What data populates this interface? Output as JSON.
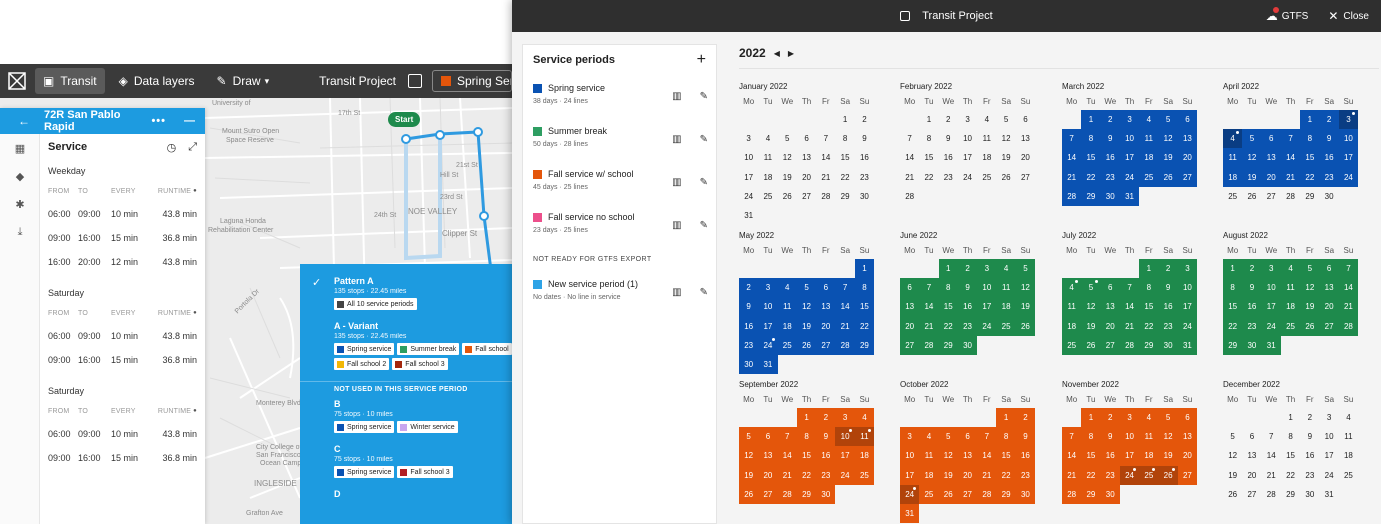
{
  "bg": {
    "toolbar": {
      "transit": "Transit",
      "data_layers": "Data layers",
      "draw": "Draw",
      "project": "Transit Project",
      "period_select": "Spring Service",
      "period_color": "#e4560b"
    },
    "map_labels": {
      "start": "Start",
      "university": "University of",
      "sutro": "Mount Sutro Open",
      "sutro2": "Space Reserve",
      "st17": "17th St",
      "fst21": "21st St",
      "hill": "Hill St",
      "st23": "23rd St",
      "st24": "24th St",
      "noe": "NOE VALLEY",
      "clipper": "Clipper St",
      "laguna": "Laguna Honda",
      "laguna2": "Rehabilitation Center",
      "portola": "Portola Dr",
      "monterey": "Monterey Blvd",
      "ccsf": "City College of",
      "ccsf2": "San Francisco",
      "ccsf3": "Ocean Campus",
      "ingleside": "INGLESIDE",
      "grafton": "Grafton Ave"
    },
    "route": {
      "name": "72R San Pablo Rapid",
      "service_title": "Service",
      "groups": [
        {
          "title": "Weekday",
          "heads": [
            "FROM",
            "TO",
            "EVERY",
            "RUNTIME"
          ],
          "rows": [
            [
              "06:00",
              "09:00",
              "10 min",
              "43.8 min"
            ],
            [
              "09:00",
              "16:00",
              "15 min",
              "36.8 min"
            ],
            [
              "16:00",
              "20:00",
              "12 min",
              "43.8 min"
            ]
          ]
        },
        {
          "title": "Saturday",
          "heads": [
            "FROM",
            "TO",
            "EVERY",
            "RUNTIME"
          ],
          "rows": [
            [
              "06:00",
              "09:00",
              "10 min",
              "43.8 min"
            ],
            [
              "09:00",
              "16:00",
              "15 min",
              "36.8 min"
            ]
          ]
        },
        {
          "title": "Saturday",
          "heads": [
            "FROM",
            "TO",
            "EVERY",
            "RUNTIME"
          ],
          "rows": [
            [
              "06:00",
              "09:00",
              "10 min",
              "43.8 min"
            ],
            [
              "09:00",
              "16:00",
              "15 min",
              "36.8 min"
            ]
          ]
        }
      ]
    },
    "patterns": {
      "items": [
        {
          "name": "Pattern A",
          "sub": "135 stops · 22.45 miles",
          "chips": [
            [
              {
                "label": "All 10 service periods",
                "color": "#444444"
              }
            ]
          ]
        },
        {
          "name": "A - Variant",
          "sub": "135 stops · 22.45 miles",
          "chips": [
            [
              {
                "label": "Spring service",
                "color": "#0a52b2"
              },
              {
                "label": "Summer break",
                "color": "#2e9e62"
              },
              {
                "label": "Fall school",
                "color": "#e4560b"
              }
            ],
            [
              {
                "label": "Fall school 2",
                "color": "#f2b705"
              },
              {
                "label": "Fall school 3",
                "color": "#a3260c"
              }
            ]
          ]
        }
      ],
      "not_used_title": "NOT USED IN THIS SERVICE PERIOD",
      "unused": [
        {
          "name": "B",
          "sub": "75 stops · 10 miles",
          "chips": [
            [
              {
                "label": "Spring service",
                "color": "#0a52b2"
              },
              {
                "label": "Winter service",
                "color": "#c9a6ef"
              }
            ]
          ]
        },
        {
          "name": "C",
          "sub": "75 stops · 10 miles",
          "chips": [
            [
              {
                "label": "Spring service",
                "color": "#0a52b2"
              },
              {
                "label": "Fall school 3",
                "color": "#b11f24"
              }
            ]
          ]
        },
        {
          "name": "D",
          "sub": "",
          "chips": []
        }
      ]
    }
  },
  "window": {
    "title": "Transit Project",
    "gtfs": "GTFS",
    "close": "Close"
  },
  "periods": {
    "title": "Service periods",
    "items": [
      {
        "name": "Spring service",
        "sub": "38 days · 24 lines",
        "color": "#0a52b2"
      },
      {
        "name": "Summer break",
        "sub": "50 days · 28 lines",
        "color": "#2e9e62"
      },
      {
        "name": "Fall service w/ school",
        "sub": "45 days · 25 lines",
        "color": "#e4560b"
      },
      {
        "name": "Fall service no school",
        "sub": "23 days · 25 lines",
        "color": "#ec4f8b"
      }
    ],
    "not_ready_title": "NOT READY FOR GTFS EXPORT",
    "not_ready": [
      {
        "name": "New service period (1)",
        "sub": "No dates · No line in service",
        "color": "#2ea3e6"
      }
    ]
  },
  "calendar": {
    "year": "2022",
    "dows": [
      "Mo",
      "Tu",
      "We",
      "Th",
      "Fr",
      "Sa",
      "Su"
    ],
    "months": [
      {
        "name": "January 2022",
        "offset": 5,
        "days": 31,
        "color": "",
        "colored": [],
        "hl": [],
        "dots": []
      },
      {
        "name": "February 2022",
        "offset": 1,
        "days": 28,
        "color": "",
        "colored": [],
        "hl": [],
        "dots": []
      },
      {
        "name": "March 2022",
        "offset": 1,
        "days": 31,
        "color": "blue",
        "colored": [
          1,
          31
        ],
        "hl": [],
        "dots": []
      },
      {
        "name": "April 2022",
        "offset": 4,
        "days": 30,
        "color": "blue",
        "colored": [
          1,
          24
        ],
        "hl": [
          3,
          4
        ],
        "dots": [
          3,
          4
        ]
      },
      {
        "name": "May 2022",
        "offset": 6,
        "days": 31,
        "color": "blue",
        "colored": [
          1,
          31
        ],
        "hl": [],
        "dots": [
          24
        ]
      },
      {
        "name": "June 2022",
        "offset": 2,
        "days": 30,
        "color": "green",
        "colored": [
          1,
          30
        ],
        "hl": [],
        "dots": []
      },
      {
        "name": "July 2022",
        "offset": 4,
        "days": 31,
        "color": "green",
        "colored": [
          1,
          31
        ],
        "hl": [],
        "dots": [
          4,
          5
        ]
      },
      {
        "name": "August 2022",
        "offset": 0,
        "days": 31,
        "color": "green",
        "colored": [
          1,
          31
        ],
        "hl": [],
        "dots": []
      },
      {
        "name": "September 2022",
        "offset": 3,
        "days": 30,
        "color": "orange",
        "colored": [
          1,
          30
        ],
        "hl": [
          10,
          11
        ],
        "dots": [
          10,
          11
        ]
      },
      {
        "name": "October 2022",
        "offset": 5,
        "days": 31,
        "color": "orange",
        "colored": [
          1,
          31
        ],
        "hl": [
          24
        ],
        "dots": [
          24
        ]
      },
      {
        "name": "November 2022",
        "offset": 1,
        "days": 30,
        "color": "orange",
        "colored": [
          1,
          30
        ],
        "hl": [
          24,
          25,
          26
        ],
        "dots": [
          24,
          25,
          26
        ]
      },
      {
        "name": "December 2022",
        "offset": 3,
        "days": 31,
        "color": "",
        "colored": [],
        "hl": [],
        "dots": []
      }
    ]
  }
}
